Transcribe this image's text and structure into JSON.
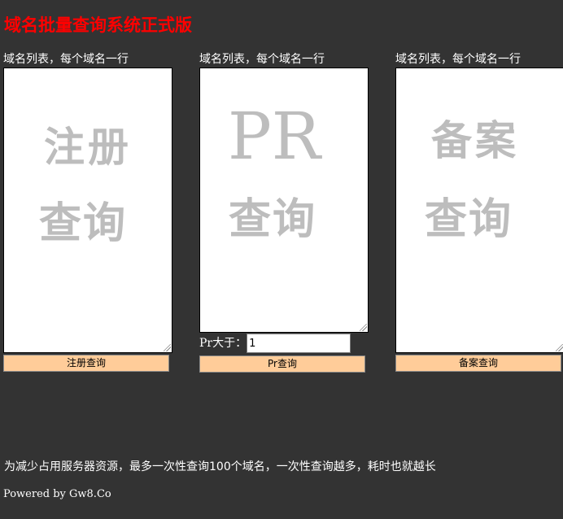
{
  "page": {
    "title": "域名批量查询系统正式版"
  },
  "columns": [
    {
      "label": "域名列表，每个域名一行",
      "watermark_line1": "注册",
      "watermark_line2": "查询",
      "textarea_value": "",
      "button_label": "注册查询"
    },
    {
      "label": "域名列表，每个域名一行",
      "watermark_line1": "PR",
      "watermark_line2": "查询",
      "textarea_value": "",
      "button_label": "Pr查询"
    },
    {
      "label": "域名列表，每个域名一行",
      "watermark_line1": "备案",
      "watermark_line2": "查询",
      "textarea_value": "",
      "button_label": "备案查询"
    }
  ],
  "pr_filter": {
    "label": "Pr大于：",
    "value": "1"
  },
  "footer": {
    "note": "为减少占用服务器资源，最多一次性查询100个域名，一次性查询越多，耗时也就越长",
    "powered_by": "Powered by Gw8.Co"
  },
  "colors": {
    "background": "#333333",
    "title": "#ff0000",
    "button_bg": "#ffcc99",
    "watermark": "#bdbdbd"
  }
}
